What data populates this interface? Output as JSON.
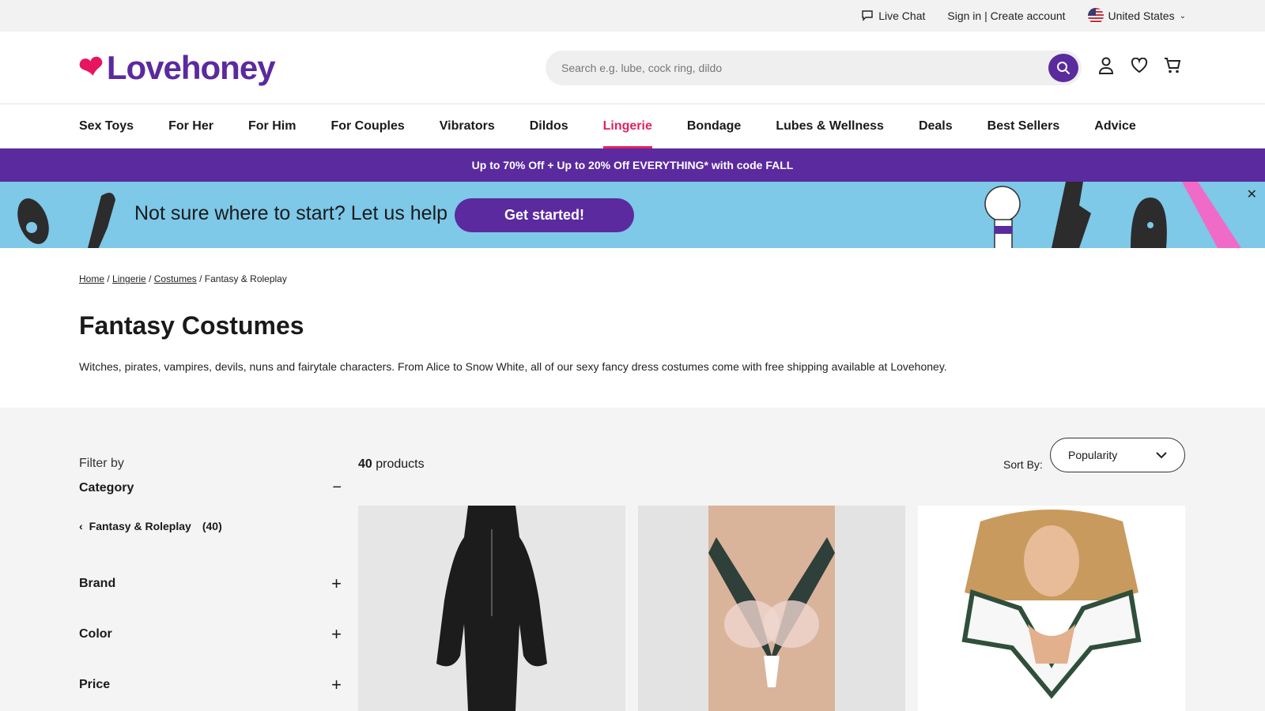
{
  "topbar": {
    "live_chat": "Live Chat",
    "sign_in": "Sign in | Create account",
    "country": "United States"
  },
  "header": {
    "logo": "Lovehoney",
    "search_placeholder": "Search e.g. lube, cock ring, dildo"
  },
  "nav": {
    "items": [
      "Sex Toys",
      "For Her",
      "For Him",
      "For Couples",
      "Vibrators",
      "Dildos",
      "Lingerie",
      "Bondage",
      "Lubes & Wellness",
      "Deals",
      "Best Sellers",
      "Advice"
    ],
    "active": "Lingerie"
  },
  "promo": {
    "text": "Up to 70% Off + Up to 20% Off EVERYTHING* with code FALL"
  },
  "helpbar": {
    "text": "Not sure where to start? Let us help",
    "button": "Get started!"
  },
  "breadcrumb": {
    "home": "Home",
    "lingerie": "Lingerie",
    "costumes": "Costumes",
    "current": "Fantasy & Roleplay"
  },
  "page": {
    "title": "Fantasy Costumes",
    "description": "Witches, pirates, vampires, devils, nuns and fairytale characters. From Alice to Snow White, all of our sexy fancy dress costumes come with free shipping available at Lovehoney."
  },
  "filters": {
    "filter_by": "Filter by",
    "category_label": "Category",
    "category_item": "Fantasy & Roleplay",
    "category_count": "(40)",
    "groups": [
      "Brand",
      "Color",
      "Price"
    ]
  },
  "results": {
    "count": "40",
    "count_suffix": "products",
    "sort_label": "Sort By:",
    "sort_value": "Popularity"
  },
  "colors": {
    "brand_purple": "#5b2a9e",
    "accent_pink": "#e0245e",
    "help_blue": "#7ec8e8"
  }
}
